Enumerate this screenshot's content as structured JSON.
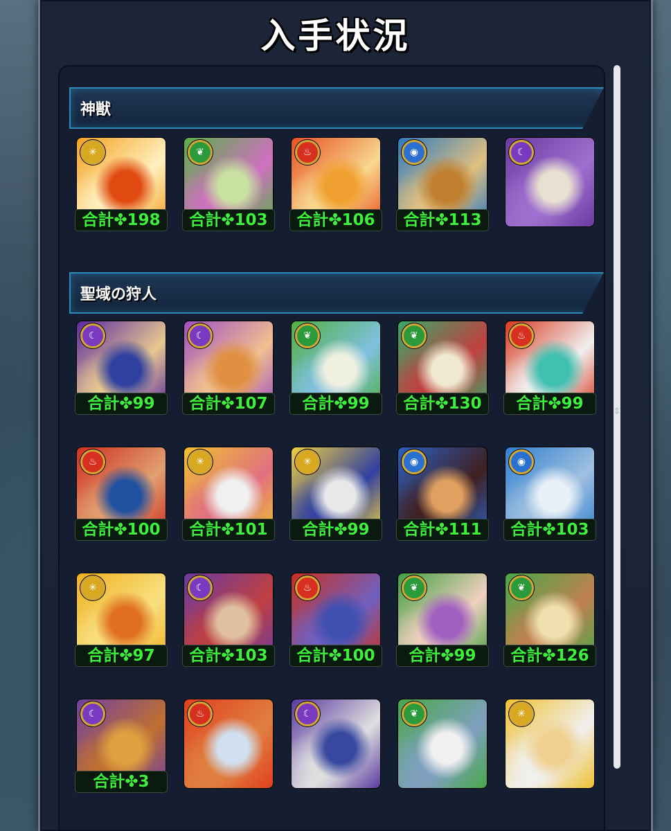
{
  "title": "入手状況",
  "sections": [
    {
      "label": "神獣",
      "cards": [
        {
          "attr": "light",
          "total": "合計✤198",
          "art": [
            "#f4a020",
            "#e04a10",
            "#fff0c0"
          ]
        },
        {
          "attr": "wood",
          "total": "合計✤103",
          "art": [
            "#58b048",
            "#c8e0a0",
            "#d070c0"
          ]
        },
        {
          "attr": "fire",
          "total": "合計✤106",
          "art": [
            "#e85020",
            "#f0a030",
            "#f8d890"
          ]
        },
        {
          "attr": "water",
          "total": "合計✤113",
          "art": [
            "#2c7ac0",
            "#c08030",
            "#e0c080"
          ]
        },
        {
          "attr": "dark",
          "total": "",
          "art": [
            "#6a3aa0",
            "#e8e0d0",
            "#a070d0"
          ]
        }
      ]
    },
    {
      "label": "聖域の狩人",
      "cards": [
        {
          "attr": "dark",
          "total": "合計✤99",
          "art": [
            "#5a2aa0",
            "#3040a0",
            "#e8c890"
          ]
        },
        {
          "attr": "dark",
          "total": "合計✤107",
          "art": [
            "#a050c0",
            "#e09040",
            "#f0c090"
          ]
        },
        {
          "attr": "wood",
          "total": "合計✤99",
          "art": [
            "#50b040",
            "#f0f0e0",
            "#80c0e0"
          ]
        },
        {
          "attr": "wood",
          "total": "合計✤130",
          "art": [
            "#38a868",
            "#f0e8d0",
            "#c04040"
          ]
        },
        {
          "attr": "fire",
          "total": "合計✤99",
          "art": [
            "#d83a20",
            "#40c0b0",
            "#f0f0f0"
          ]
        },
        {
          "attr": "fire",
          "total": "合計✤100",
          "art": [
            "#d03020",
            "#2050a0",
            "#e0a070"
          ]
        },
        {
          "attr": "light",
          "total": "合計✤101",
          "art": [
            "#f0c030",
            "#f0f0f0",
            "#e07080"
          ]
        },
        {
          "attr": "light",
          "total": "合計✤99",
          "art": [
            "#f0d040",
            "#e8e8e8",
            "#3040a0"
          ]
        },
        {
          "attr": "water",
          "total": "合計✤111",
          "art": [
            "#2a60c0",
            "#e0a060",
            "#402020"
          ]
        },
        {
          "attr": "water",
          "total": "合計✤103",
          "art": [
            "#3080d0",
            "#e8f0f8",
            "#a0c0e0"
          ]
        },
        {
          "attr": "light",
          "total": "合計✤97",
          "art": [
            "#f0b020",
            "#e07020",
            "#f8e080"
          ]
        },
        {
          "attr": "dark",
          "total": "合計✤103",
          "art": [
            "#6a3aa0",
            "#e0c0a0",
            "#c04040"
          ]
        },
        {
          "attr": "fire",
          "total": "合計✤100",
          "art": [
            "#c83020",
            "#4050b0",
            "#7060c0"
          ]
        },
        {
          "attr": "wood",
          "total": "合計✤99",
          "art": [
            "#40a040",
            "#a060c0",
            "#f0d0c0"
          ]
        },
        {
          "attr": "wood",
          "total": "合計✤126",
          "art": [
            "#48a848",
            "#f0e0b0",
            "#c08050"
          ]
        },
        {
          "attr": "dark",
          "total": "合計✤3",
          "art": [
            "#7040a0",
            "#e0a040",
            "#c07030"
          ]
        },
        {
          "attr": "fire",
          "total": "",
          "art": [
            "#e04020",
            "#d0e0f0",
            "#e08040"
          ]
        },
        {
          "attr": "dark",
          "total": "",
          "art": [
            "#5a3aa0",
            "#3848a0",
            "#e0e0e0"
          ]
        },
        {
          "attr": "wood",
          "total": "",
          "art": [
            "#48a848",
            "#f0f0f0",
            "#80a0c0"
          ]
        },
        {
          "attr": "light",
          "total": "",
          "art": [
            "#f0c030",
            "#f0d090",
            "#f0f0f0"
          ]
        }
      ]
    }
  ],
  "attr_colors": {
    "fire": "#d83020",
    "water": "#2a70d0",
    "wood": "#2a9a3a",
    "light": "#d8a820",
    "dark": "#7a3ac0"
  },
  "attr_icons": {
    "fire": "flame-icon",
    "water": "water-drop-icon",
    "wood": "leaf-icon",
    "light": "sun-icon",
    "dark": "moon-icon"
  }
}
